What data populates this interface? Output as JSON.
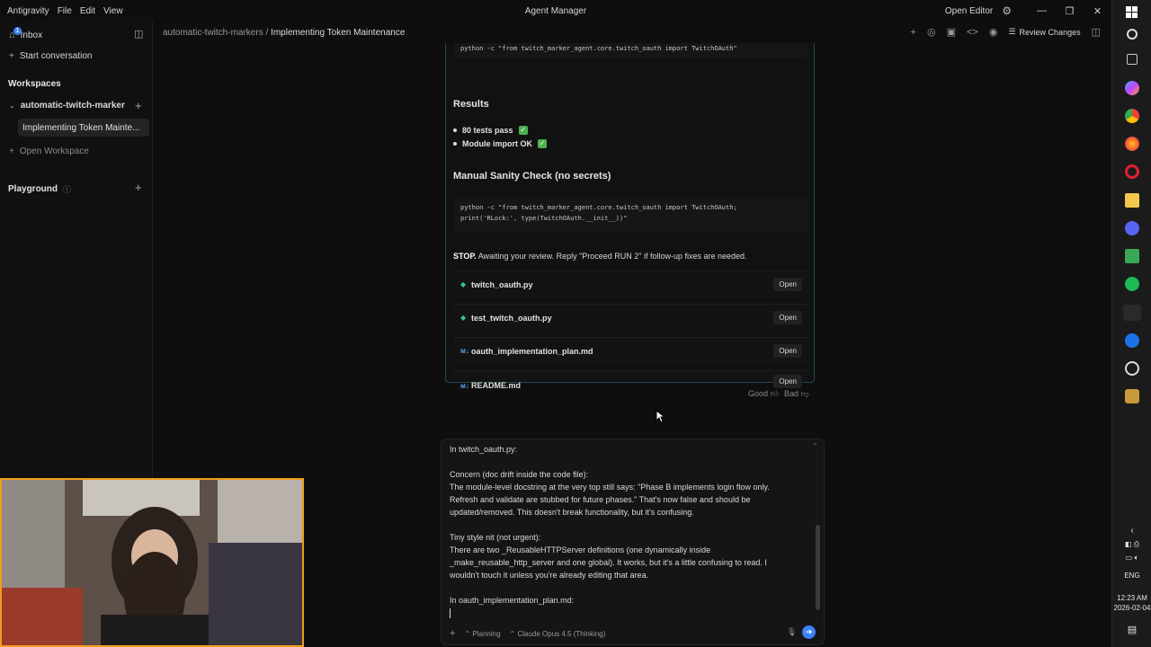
{
  "window": {
    "menu": [
      "Antigravity",
      "File",
      "Edit",
      "View"
    ],
    "title": "Agent Manager",
    "open_editor": "Open Editor"
  },
  "sidebar": {
    "inbox": "Inbox",
    "inbox_badge": "1",
    "start_conversation": "Start conversation",
    "workspaces": "Workspaces",
    "workspace_name": "automatic-twitch-marker",
    "active_conversation": "Implementing Token Mainte...",
    "open_workspace": "Open Workspace",
    "playground": "Playground"
  },
  "header": {
    "breadcrumb_root": "automatic-twitch-markers",
    "breadcrumb_sep": "/",
    "breadcrumb_current": "Implementing Token Maintenance",
    "review_changes": "Review Changes"
  },
  "content": {
    "code_top": "python -c \"from twitch_marker_agent.core.twitch_oauth import TwitchOAuth\"",
    "results_heading": "Results",
    "results": [
      "80 tests pass",
      "Module import OK"
    ],
    "sanity_heading": "Manual Sanity Check (no secrets)",
    "sanity_code_line1": "python -c \"from twitch_marker_agent.core.twitch_oauth import TwitchOAuth;",
    "sanity_code_line2": "print('RLock:', type(TwitchOAuth.__init__))\"",
    "stop_label": "STOP.",
    "stop_text": " Awaiting your review. Reply \"Proceed RUN 2\" if follow-up fixes are needed.",
    "files": [
      {
        "name": "twitch_oauth.py",
        "kind": "py",
        "action": "Open"
      },
      {
        "name": "test_twitch_oauth.py",
        "kind": "py",
        "action": "Open"
      },
      {
        "name": "oauth_implementation_plan.md",
        "kind": "md",
        "action": "Open"
      },
      {
        "name": "README.md",
        "kind": "md",
        "action": "Open"
      }
    ],
    "feedback_good": "Good",
    "feedback_bad": "Bad"
  },
  "composer": {
    "lines": [
      "In twitch_oauth.py:",
      "",
      "Concern (doc drift inside the code file):",
      "The module-level docstring at the very top still says: \"Phase B implements login flow only.",
      "Refresh and validate are stubbed for future phases.\" That's now false and should be",
      "updated/removed. This doesn't break functionality, but it's confusing.",
      "",
      "Tiny style nit (not urgent):",
      "There are two _ReusableHTTPServer definitions (one dynamically inside",
      "_make_reusable_http_server and one global). It works, but it's a little confusing to read. I",
      "wouldn't touch it unless you're already editing that area.",
      "",
      "In oauth_implementation_plan.md:"
    ],
    "mode": "Planning",
    "model": "Claude Opus 4.5 (Thinking)"
  },
  "tray": {
    "lang": "ENG",
    "time": "12:23 AM",
    "date": "2026-02-04"
  }
}
